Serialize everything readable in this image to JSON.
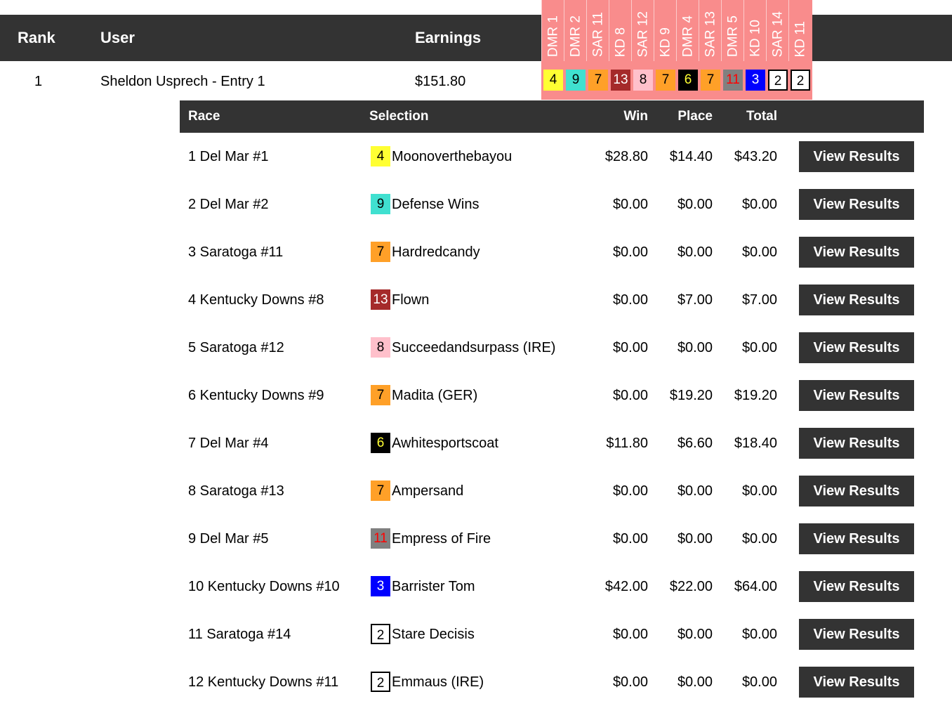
{
  "header": {
    "rank_label": "Rank",
    "user_label": "User",
    "earnings_label": "Earnings"
  },
  "races_header": [
    "DMR 1",
    "DMR 2",
    "SAR 11",
    "KD 8",
    "SAR 12",
    "KD 9",
    "DMR 4",
    "SAR 13",
    "DMR 5",
    "KD 10",
    "SAR 14",
    "KD 11"
  ],
  "entry": {
    "rank": "1",
    "user": "Sheldon Usprech - Entry 1",
    "earnings": "$151.80",
    "picks": [
      {
        "num": "4",
        "bg": "#ffff33",
        "fg": "#000000"
      },
      {
        "num": "9",
        "bg": "#40e0d0",
        "fg": "#000000"
      },
      {
        "num": "7",
        "bg": "#ffa028",
        "fg": "#000000"
      },
      {
        "num": "13",
        "bg": "#a52a2a",
        "fg": "#ffffff"
      },
      {
        "num": "8",
        "bg": "#ffc0cb",
        "fg": "#000000"
      },
      {
        "num": "7",
        "bg": "#ffa028",
        "fg": "#000000"
      },
      {
        "num": "6",
        "bg": "#000000",
        "fg": "#ffff33"
      },
      {
        "num": "7",
        "bg": "#ffa028",
        "fg": "#000000"
      },
      {
        "num": "11",
        "bg": "#808080",
        "fg": "#ff0000"
      },
      {
        "num": "3",
        "bg": "#0000ff",
        "fg": "#ffffff"
      },
      {
        "num": "2",
        "bg": "#ffffff",
        "fg": "#000000",
        "border": "#000000"
      },
      {
        "num": "2",
        "bg": "#ffffff",
        "fg": "#000000",
        "border": "#000000"
      }
    ]
  },
  "details": {
    "headers": {
      "race": "Race",
      "selection": "Selection",
      "win": "Win",
      "place": "Place",
      "total": "Total"
    },
    "button_label": "View Results",
    "rows": [
      {
        "race": "1 Del Mar #1",
        "num": "4",
        "bg": "#ffff33",
        "fg": "#000000",
        "horse": "Moonoverthebayou",
        "win": "$28.80",
        "place": "$14.40",
        "total": "$43.20"
      },
      {
        "race": "2 Del Mar #2",
        "num": "9",
        "bg": "#40e0d0",
        "fg": "#000000",
        "horse": "Defense Wins",
        "win": "$0.00",
        "place": "$0.00",
        "total": "$0.00"
      },
      {
        "race": "3 Saratoga #11",
        "num": "7",
        "bg": "#ffa028",
        "fg": "#000000",
        "horse": "Hardredcandy",
        "win": "$0.00",
        "place": "$0.00",
        "total": "$0.00"
      },
      {
        "race": "4 Kentucky Downs #8",
        "num": "13",
        "bg": "#a52a2a",
        "fg": "#ffffff",
        "horse": "Flown",
        "win": "$0.00",
        "place": "$7.00",
        "total": "$7.00"
      },
      {
        "race": "5 Saratoga #12",
        "num": "8",
        "bg": "#ffc0cb",
        "fg": "#000000",
        "horse": "Succeedandsurpass (IRE)",
        "win": "$0.00",
        "place": "$0.00",
        "total": "$0.00"
      },
      {
        "race": "6 Kentucky Downs #9",
        "num": "7",
        "bg": "#ffa028",
        "fg": "#000000",
        "horse": "Madita (GER)",
        "win": "$0.00",
        "place": "$19.20",
        "total": "$19.20"
      },
      {
        "race": "7 Del Mar #4",
        "num": "6",
        "bg": "#000000",
        "fg": "#ffff33",
        "horse": "Awhitesportscoat",
        "win": "$11.80",
        "place": "$6.60",
        "total": "$18.40"
      },
      {
        "race": "8 Saratoga #13",
        "num": "7",
        "bg": "#ffa028",
        "fg": "#000000",
        "horse": "Ampersand",
        "win": "$0.00",
        "place": "$0.00",
        "total": "$0.00"
      },
      {
        "race": "9 Del Mar #5",
        "num": "11",
        "bg": "#808080",
        "fg": "#ff0000",
        "horse": "Empress of Fire",
        "win": "$0.00",
        "place": "$0.00",
        "total": "$0.00"
      },
      {
        "race": "10 Kentucky Downs #10",
        "num": "3",
        "bg": "#0000ff",
        "fg": "#ffffff",
        "horse": "Barrister Tom",
        "win": "$42.00",
        "place": "$22.00",
        "total": "$64.00"
      },
      {
        "race": "11 Saratoga #14",
        "num": "2",
        "bg": "#ffffff",
        "fg": "#000000",
        "border": "#000000",
        "horse": "Stare Decisis",
        "win": "$0.00",
        "place": "$0.00",
        "total": "$0.00"
      },
      {
        "race": "12 Kentucky Downs #11",
        "num": "2",
        "bg": "#ffffff",
        "fg": "#000000",
        "border": "#000000",
        "horse": "Emmaus (IRE)",
        "win": "$0.00",
        "place": "$0.00",
        "total": "$0.00"
      }
    ]
  }
}
